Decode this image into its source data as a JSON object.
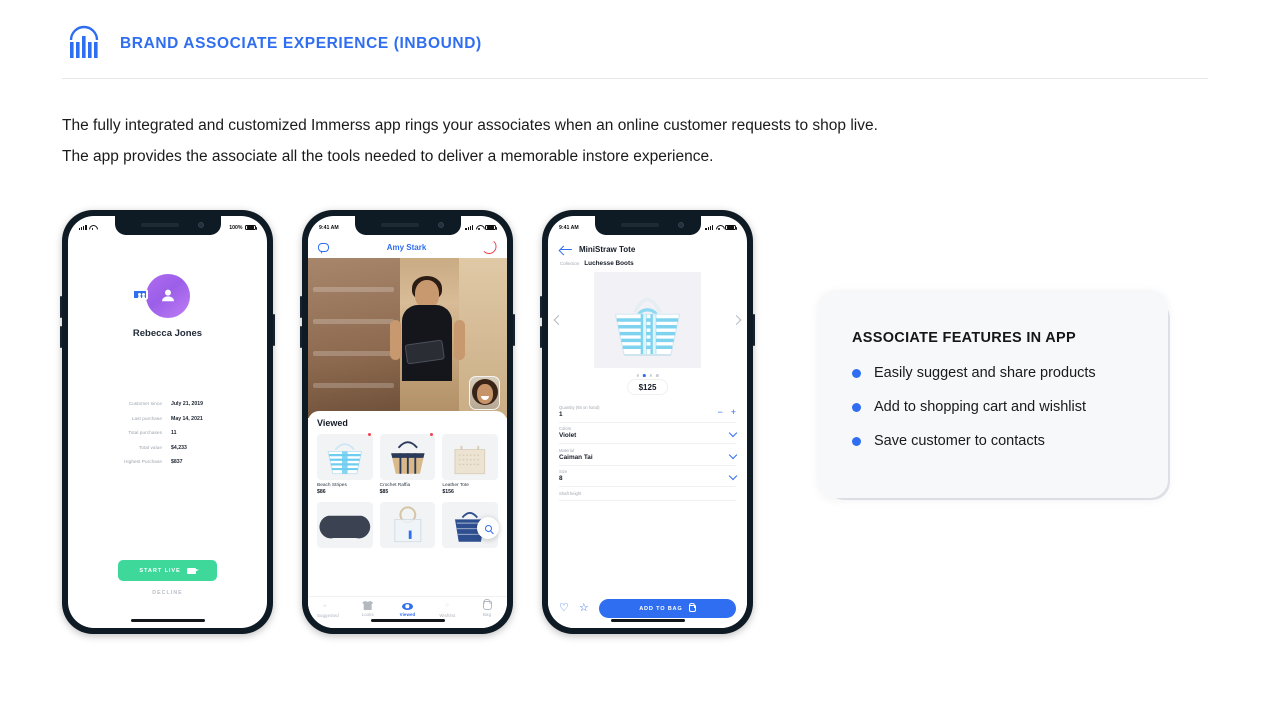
{
  "header": {
    "title": "BRAND ASSOCIATE EXPERIENCE (INBOUND)",
    "logo_name": "immerss-logo",
    "accent_color": "#2f6ef0"
  },
  "intro": {
    "line1": "The fully integrated and customized Immerss app rings your associates when an online customer requests to shop live.",
    "line2": "The app provides the associate all the tools needed to deliver a memorable instore experience."
  },
  "phone1": {
    "status": {
      "time": "",
      "battery": "100%"
    },
    "profile_name": "Rebecca Jones",
    "stats": [
      {
        "label": "Customer since",
        "value": "July 21, 2019"
      },
      {
        "label": "Last purchase",
        "value": "May 14, 2021"
      },
      {
        "label": "Total purchases",
        "value": "11"
      },
      {
        "label": "Total value",
        "value": "$4,233"
      },
      {
        "label": "Highest Purchase",
        "value": "$837"
      }
    ],
    "start_live_label": "START LIVE",
    "decline_label": "DECLINE"
  },
  "phone2": {
    "status": {
      "time": "9:41 AM"
    },
    "caller_name": "Amy Stark",
    "section_title": "Viewed",
    "products": [
      {
        "name": "Beach Stripes",
        "price": "$86"
      },
      {
        "name": "Crochet Raffia",
        "price": "$85"
      },
      {
        "name": "Leather Tote",
        "price": "$156"
      }
    ],
    "tabs": [
      {
        "label": "Suggested",
        "icon": "star-icon",
        "active": false
      },
      {
        "label": "Looks",
        "icon": "shirt-icon",
        "active": false
      },
      {
        "label": "Viewed",
        "icon": "eye-icon",
        "active": true
      },
      {
        "label": "Wishlist",
        "icon": "heart-icon",
        "active": false
      },
      {
        "label": "Bag",
        "icon": "bag-icon",
        "active": false
      }
    ]
  },
  "phone3": {
    "status": {
      "time": "9:41 AM"
    },
    "title": "MiniStraw Tote",
    "collection_label": "Collection",
    "collection_value": "Luchesse Boots",
    "price": "$125",
    "carousel_dots": 4,
    "carousel_active": 2,
    "rows": [
      {
        "key": "Quantity (65 on hand)",
        "value": "1",
        "control": "stepper"
      },
      {
        "key": "Colors",
        "value": "Violet",
        "control": "chevron"
      },
      {
        "key": "Material",
        "value": "Caiman Tai",
        "control": "chevron"
      },
      {
        "key": "Size",
        "value": "8",
        "control": "chevron"
      },
      {
        "key": "Shaft height",
        "value": "",
        "control": "chevron"
      }
    ],
    "add_to_bag_label": "ADD TO BAG",
    "minus": "−",
    "plus": "+"
  },
  "features": {
    "title": "ASSOCIATE FEATURES IN APP",
    "items": [
      "Easily suggest and share products",
      "Add to shopping cart and wishlist",
      "Save customer to contacts"
    ],
    "bullet_color": "#2f6ef0"
  }
}
